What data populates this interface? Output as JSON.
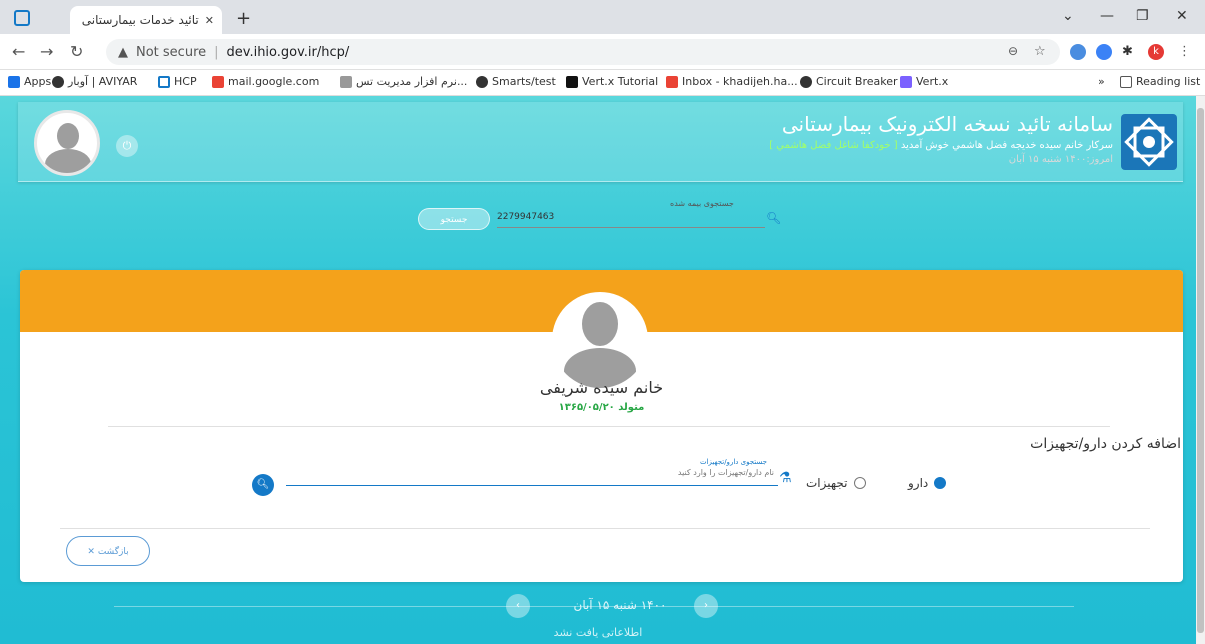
{
  "browser": {
    "tab_title": "تائید خدمات بیمارستانی",
    "security": "Not secure",
    "url": "dev.ihio.gov.ir/hcp/",
    "bookmarks": [
      "Apps",
      "آوبار | AVIYAR",
      "HCP",
      "mail.google.com",
      "نرم افزار مدیریت تس...",
      "Smarts/test",
      "Vert.x Tutorial",
      "Inbox - khadijeh.ha...",
      "Circuit Breaker",
      "Vert.x"
    ],
    "reading_list": "Reading list",
    "profile_initial": "k"
  },
  "header": {
    "title": "سامانه تائید نسخه الکترونیک بیمارستانی",
    "welcome_prefix": "سرکار خانم سیده خدیجه فضل هاشمي خوش آمدید",
    "welcome_role": "[ خودکفا شاغل فضل هاشمي ]",
    "today": "امروز:۱۴۰۰ شنبه ۱۵ آبان"
  },
  "search": {
    "label": "جستجوی بیمه شده",
    "value": "2279947463",
    "button": "جستجو"
  },
  "patient": {
    "name": "خانم سیده شریفی",
    "dob": "متولد ۱۳۶۵/۰۵/۲۰"
  },
  "add_section": {
    "title": "اضافه کردن دارو/تجهیزات",
    "option_drug": "دارو",
    "option_equipment": "تجهیزات",
    "selected": "دارو",
    "input_label": "جستجوی دارو/تجهیزات",
    "input_placeholder": "نام دارو/تجهیزات را وارد کنید",
    "back_button": "بازگشت"
  },
  "pager": {
    "date": "۱۴۰۰ شنبه ۱۵ آبان",
    "no_data": "اطلاعاتی یافت نشد"
  },
  "colors": {
    "accent": "#1479c7",
    "orange": "#f4a21b",
    "green": "#28a745",
    "teal": "#2bc4d6"
  }
}
